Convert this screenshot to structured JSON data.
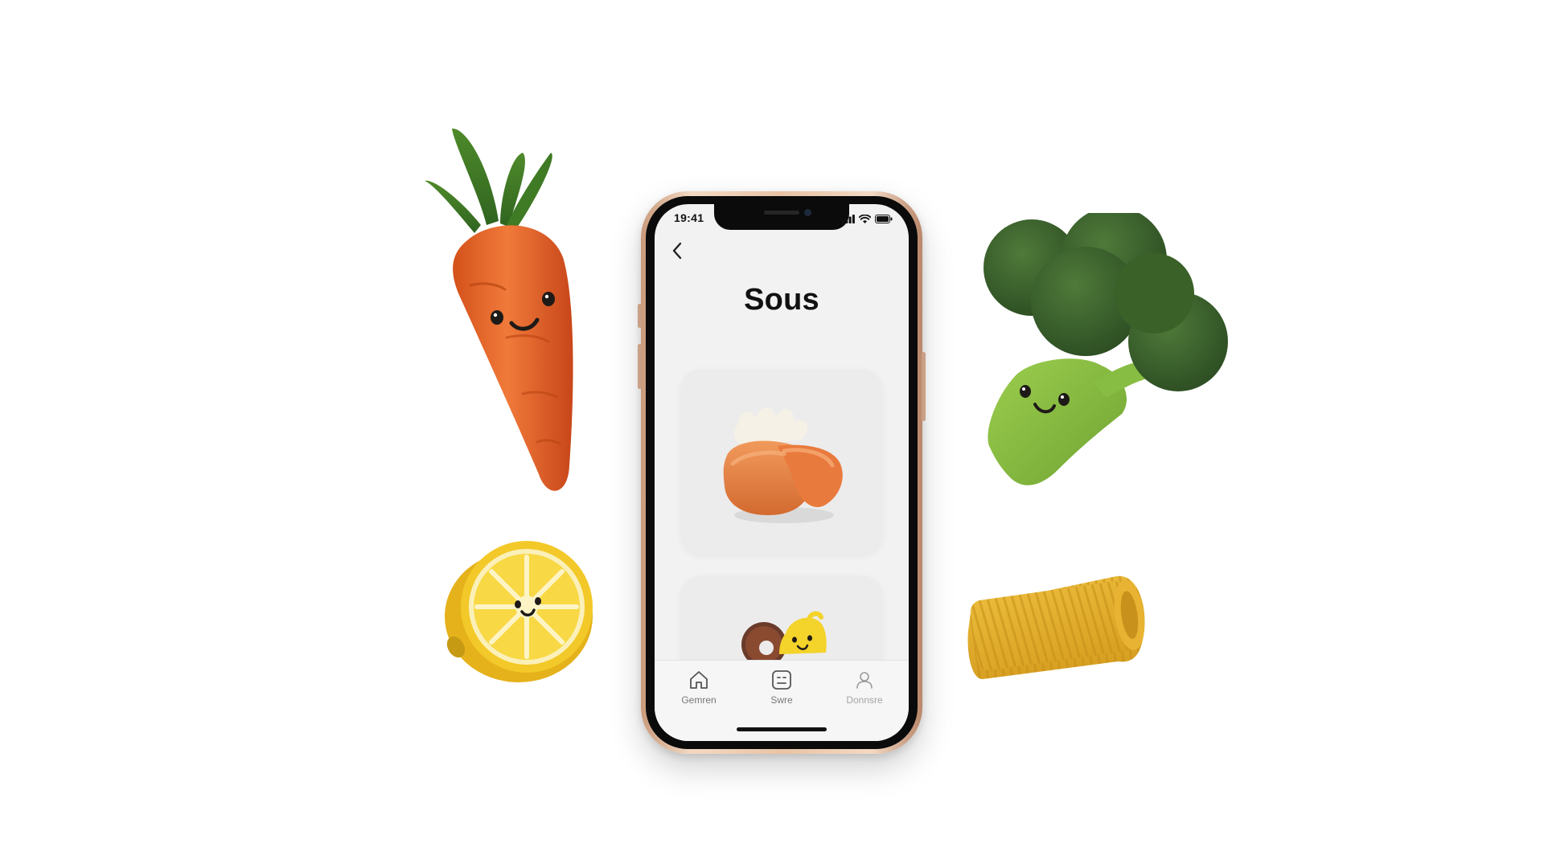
{
  "status_bar": {
    "time": "19:41",
    "icons": [
      "signal-icon",
      "wifi-icon",
      "battery-icon"
    ]
  },
  "nav": {
    "back_icon": "chevron-left-icon"
  },
  "page": {
    "title": "Sous"
  },
  "cards": [
    {
      "illustration": "bread-toast-illustration"
    },
    {
      "illustration": "donut-lemon-illustration"
    }
  ],
  "tab_bar": {
    "items": [
      {
        "label": "Gemren",
        "icon": "home-icon",
        "active": true
      },
      {
        "label": "Swre",
        "icon": "face-box-icon",
        "active": true
      },
      {
        "label": "Donnsre",
        "icon": "user-icon",
        "active": false
      }
    ]
  },
  "decorations": [
    "carrot-character",
    "lemon-half-character",
    "broccoli-character",
    "rigatoni-pasta"
  ],
  "colors": {
    "background": "#ffffff",
    "screen": "#f2f2f2",
    "frame": "#e8c3a5",
    "title": "#111111",
    "tab_label": "#777777"
  }
}
